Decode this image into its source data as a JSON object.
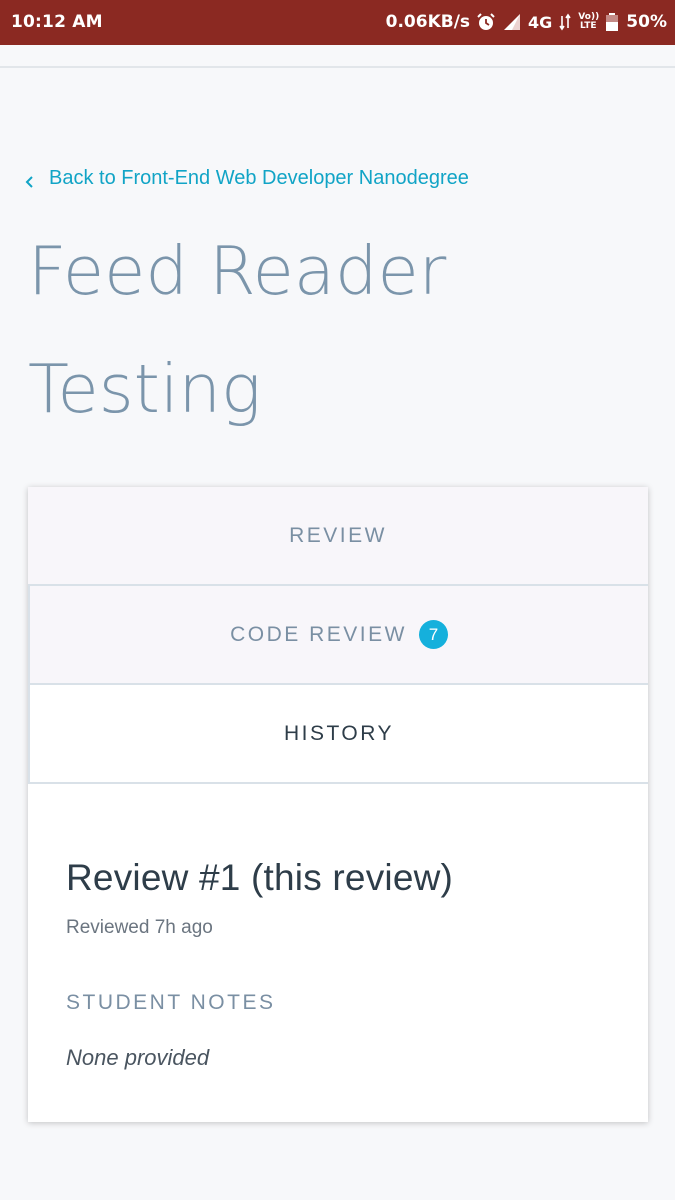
{
  "status_bar": {
    "time": "10:12 AM",
    "speed": "0.06KB/s",
    "network": "4G",
    "volte_top": "Vo))",
    "volte_bottom": "LTE",
    "battery": "50%",
    "color": "#8b2922"
  },
  "back_link": {
    "label": "Back to Front-End Web Developer Nanodegree",
    "icon": "chevron-left-icon"
  },
  "page_title": "Feed Reader Testing",
  "tabs": [
    {
      "label": "REVIEW",
      "active": false
    },
    {
      "label": "CODE REVIEW",
      "badge": "7",
      "active": false
    },
    {
      "label": "HISTORY",
      "active": true
    }
  ],
  "review": {
    "title": "Review #1 (this review)",
    "meta": "Reviewed 7h ago",
    "notes_heading": "STUDENT NOTES",
    "notes_text": "None provided"
  },
  "colors": {
    "accent": "#11a4c6",
    "badge": "#15b0dc",
    "title": "#7b95ab",
    "text_dark": "#2e3d49"
  }
}
